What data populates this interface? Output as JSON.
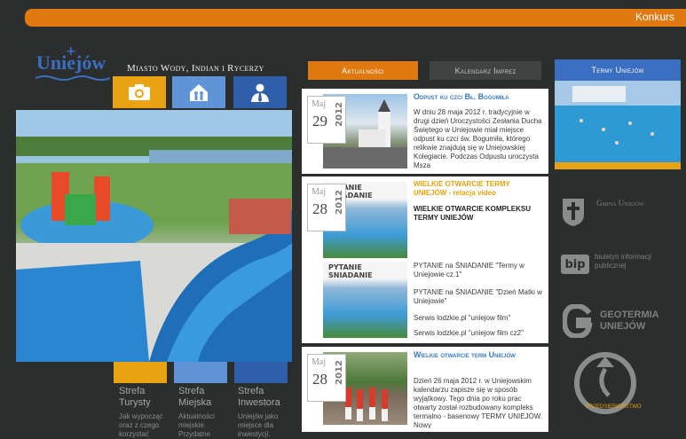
{
  "topbar": {
    "label": "Konkurs"
  },
  "logo": {
    "text": "Uniejów"
  },
  "tagline": "Miasto Wody, Indian i Rycerzy",
  "icons": [
    "camera-icon",
    "family-icon",
    "business-person-icon"
  ],
  "strefy": [
    {
      "title": "Strefa\nTurysty",
      "desc": "Jak wypocząć oraz z czego korzystać"
    },
    {
      "title": "Strefa\nMiejska",
      "desc": "Aktualności miejskie. Przydatne"
    },
    {
      "title": "Strefa\nInwestora",
      "desc": "Uniejów jako miejsce dla inwestycji."
    }
  ],
  "tabs": {
    "active": "Aktualności",
    "other": "Kalendarz Imprez"
  },
  "news": [
    {
      "month": "Maj",
      "day": "29",
      "year": "2012",
      "title": "Odpust ku czci Bł. Bogumiła",
      "lines": [
        "W dniu 28 maja 2012 r. tradycyjnie w drugi dzień Uroczystości Zesłania Ducha Świętego w Uniejowie miał miejsce odpust ku czci św. Bogumiła, którego relikwie znajdują się w Uniejowskiej Kolegiacie. Podczas Odpustu uroczysta Msza"
      ]
    },
    {
      "month": "Maj",
      "day": "28",
      "year": "2012",
      "title": "WIELKIE OTWARCIE TERMY UNIEJÓW - relacja video",
      "subtitle": "WIELKIE OTWARCIE KOMPLEKSU TERMY UNIEJÓW",
      "lines": [
        "PYTANIE na ŚNIADANIE \"Termy w Uniejowie cz.1\"",
        "PYTANIE na ŚNIADANIE \"Dzień Matki w Uniejowie\"",
        "Serwis lodzkie.pl  \"uniejow film\"",
        "Serwis lodzkie.pl  \"uniejow film cz2\""
      ],
      "thumb_label": "PYTANIE SNIADANIE"
    },
    {
      "month": "Maj",
      "day": "28",
      "year": "2012",
      "title": "Wielkie otwarcie term Uniejów",
      "lines": [
        "Dzień 26 maja 2012 r. w Uniejowskim kalendarzu zapisze się w sposób wyjątkowy. Tego dnia po roku prac otwarty został rozbudowany kompleks termalno - basenowy TERMY UNIEJÓW. Nowy"
      ]
    }
  ],
  "right": {
    "termy_title": "Termy Uniejów",
    "gmina": "Gmina Uniejów",
    "bip": "biuletyn informacji publicznej",
    "bip_logo": "bip",
    "geotermia": [
      "GEOTERMIA",
      "UNIEJÓW"
    ],
    "bottom_logo": "PRZEDSIĘBIORSTWO"
  },
  "colors": {
    "accent": "#e07a10",
    "blue": "#3b6fc2",
    "yellow": "#e8a212",
    "bg": "#2b2e2d"
  }
}
